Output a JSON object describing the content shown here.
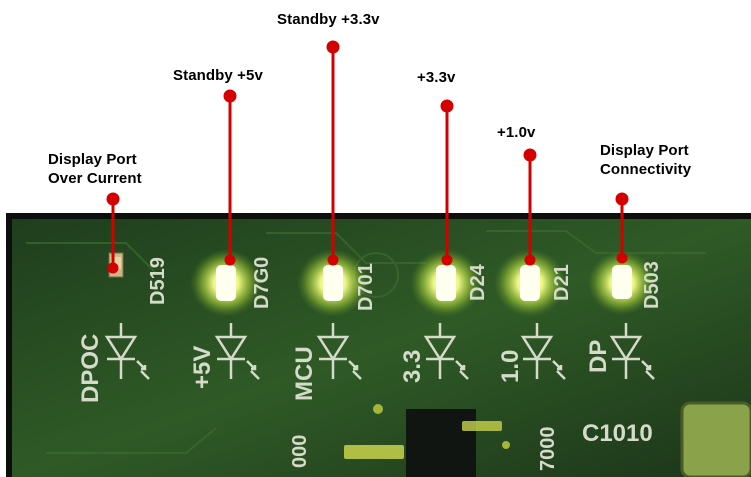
{
  "colors": {
    "callout_line": "#d40000",
    "led_glow": "#f7ff8a",
    "pcb_green": "#2f5a26",
    "silkscreen": "#d5dbc9"
  },
  "callouts": [
    {
      "id": "dpoc",
      "label_lines": [
        "Display Port",
        "Over Current"
      ],
      "designator": "D519",
      "silk": "DPOC",
      "lit": false
    },
    {
      "id": "standby-5v",
      "label_lines": [
        "Standby +5v"
      ],
      "designator": "D7G0",
      "silk": "+5V",
      "lit": true
    },
    {
      "id": "standby-3v3",
      "label_lines": [
        "Standby +3.3v"
      ],
      "designator": "D701",
      "silk": "MCU",
      "lit": true
    },
    {
      "id": "3v3",
      "label_lines": [
        "+3.3v"
      ],
      "designator": "D24",
      "silk": "3.3",
      "lit": true
    },
    {
      "id": "1v0",
      "label_lines": [
        "+1.0v"
      ],
      "designator": "D21",
      "silk": "1.0",
      "lit": true
    },
    {
      "id": "dp-connectivity",
      "label_lines": [
        "Display Port",
        "Connectivity"
      ],
      "designator": "D503",
      "silk": "DP",
      "lit": true
    }
  ],
  "board_text": {
    "cap_label": "C1010",
    "lower_labels": [
      "000",
      "7000"
    ]
  }
}
